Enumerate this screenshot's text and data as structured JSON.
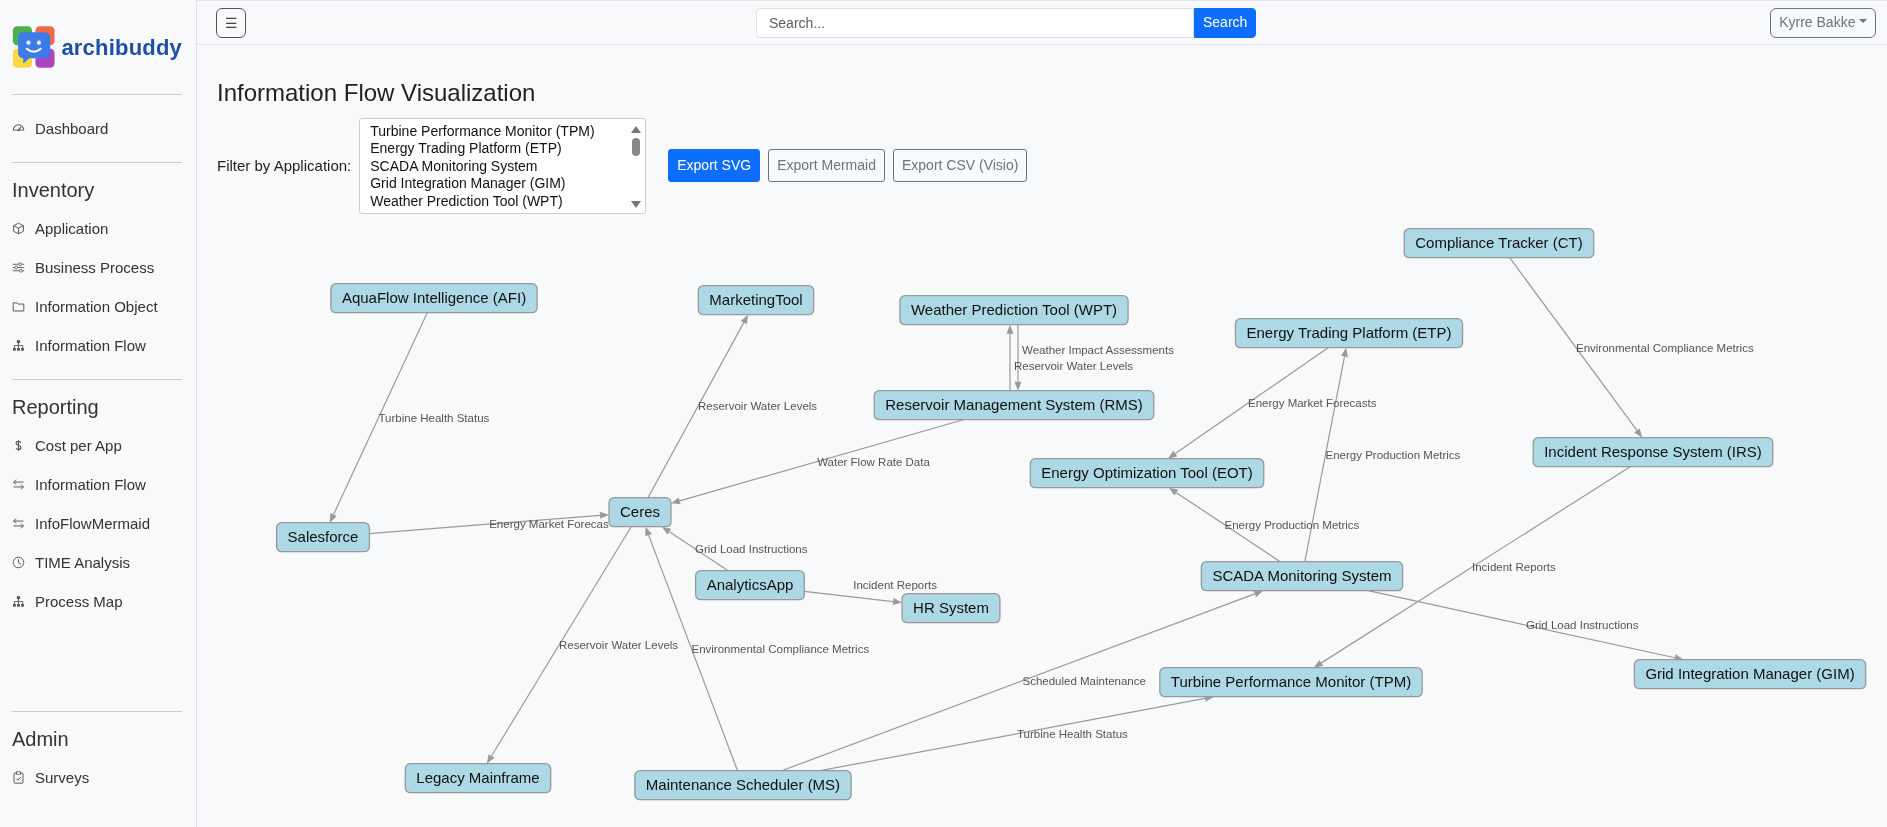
{
  "navbar": {
    "menu_button": "☰",
    "search": {
      "placeholder": "Search...",
      "button": "Search"
    },
    "user": "Kyrre Bakke"
  },
  "sidebar": {
    "brand": "archibuddy",
    "items": [
      {
        "label": "Dashboard",
        "selected": false
      }
    ],
    "sections": [
      {
        "title": "Inventory",
        "items": [
          {
            "label": "Application",
            "selected": false
          },
          {
            "label": "Business Process",
            "selected": false
          },
          {
            "label": "Information Object",
            "selected": false
          },
          {
            "label": "Information Flow",
            "selected": false
          }
        ]
      },
      {
        "title": "Reporting",
        "items": [
          {
            "label": "Cost per App",
            "selected": false
          },
          {
            "label": "Information Flow",
            "selected": false
          },
          {
            "label": "InfoFlowMermaid",
            "selected": false
          },
          {
            "label": "TIME Analysis",
            "selected": false
          },
          {
            "label": "Process Map",
            "selected": false
          }
        ]
      },
      {
        "title": "Admin",
        "items": [
          {
            "label": "Surveys",
            "selected": false
          }
        ]
      }
    ]
  },
  "page": {
    "title": "Information Flow Visualization",
    "filter": {
      "label": "Filter by Application:",
      "options": [
        {
          "label": "Turbine Performance Monitor (TPM)",
          "selected": false
        },
        {
          "label": "Energy Trading Platform (ETP)",
          "selected": false
        },
        {
          "label": "SCADA Monitoring System",
          "selected": false
        },
        {
          "label": "Grid Integration Manager (GIM)",
          "selected": false
        },
        {
          "label": "Weather Prediction Tool (WPT)",
          "selected": false
        }
      ]
    },
    "buttons": [
      {
        "label": "Export SVG",
        "kind": "primary"
      },
      {
        "label": "Export Mermaid",
        "kind": "secondary"
      },
      {
        "label": "Export CSV (Visio)",
        "kind": "secondary"
      }
    ]
  },
  "graph": {
    "nodes": [
      {
        "label": "Compliance Tracker (CT)"
      },
      {
        "label": "AquaFlow Intelligence (AFI)"
      },
      {
        "label": "MarketingTool"
      },
      {
        "label": "Weather Prediction Tool (WPT)"
      },
      {
        "label": "Energy Trading Platform (ETP)"
      },
      {
        "label": "Reservoir Management System (RMS)"
      },
      {
        "label": "Incident Response System (IRS)"
      },
      {
        "label": "Energy Optimization Tool (EOT)"
      },
      {
        "label": "Ceres"
      },
      {
        "label": "Salesforce"
      },
      {
        "label": "SCADA Monitoring System"
      },
      {
        "label": "AnalyticsApp"
      },
      {
        "label": "HR System"
      },
      {
        "label": "Grid Integration Manager (GIM)"
      },
      {
        "label": "Turbine Performance Monitor (TPM)"
      },
      {
        "label": "Legacy Mainframe"
      },
      {
        "label": "Maintenance Scheduler (MS)"
      }
    ],
    "edges": [
      {
        "label": "Weather Impact Assessments"
      },
      {
        "label": "Environmental Compliance Metrics"
      },
      {
        "label": "Reservoir Water Levels"
      },
      {
        "label": "Reservoir Water Levels"
      },
      {
        "label": "Energy Market Forecasts"
      },
      {
        "label": "Turbine Health Status"
      },
      {
        "label": "Water Flow Rate Data"
      },
      {
        "label": "Energy Production Metrics"
      },
      {
        "label": "Energy Market Forecas"
      },
      {
        "label": "Energy Production Metrics"
      },
      {
        "label": "Grid Load Instructions"
      },
      {
        "label": "Incident Reports"
      },
      {
        "label": "Incident Reports"
      },
      {
        "label": "Grid Load Instructions"
      },
      {
        "label": "Reservoir Water Levels"
      },
      {
        "label": "Environmental Compliance Metrics"
      },
      {
        "label": "Scheduled Maintenance"
      },
      {
        "label": "Turbine Health Status"
      }
    ]
  }
}
